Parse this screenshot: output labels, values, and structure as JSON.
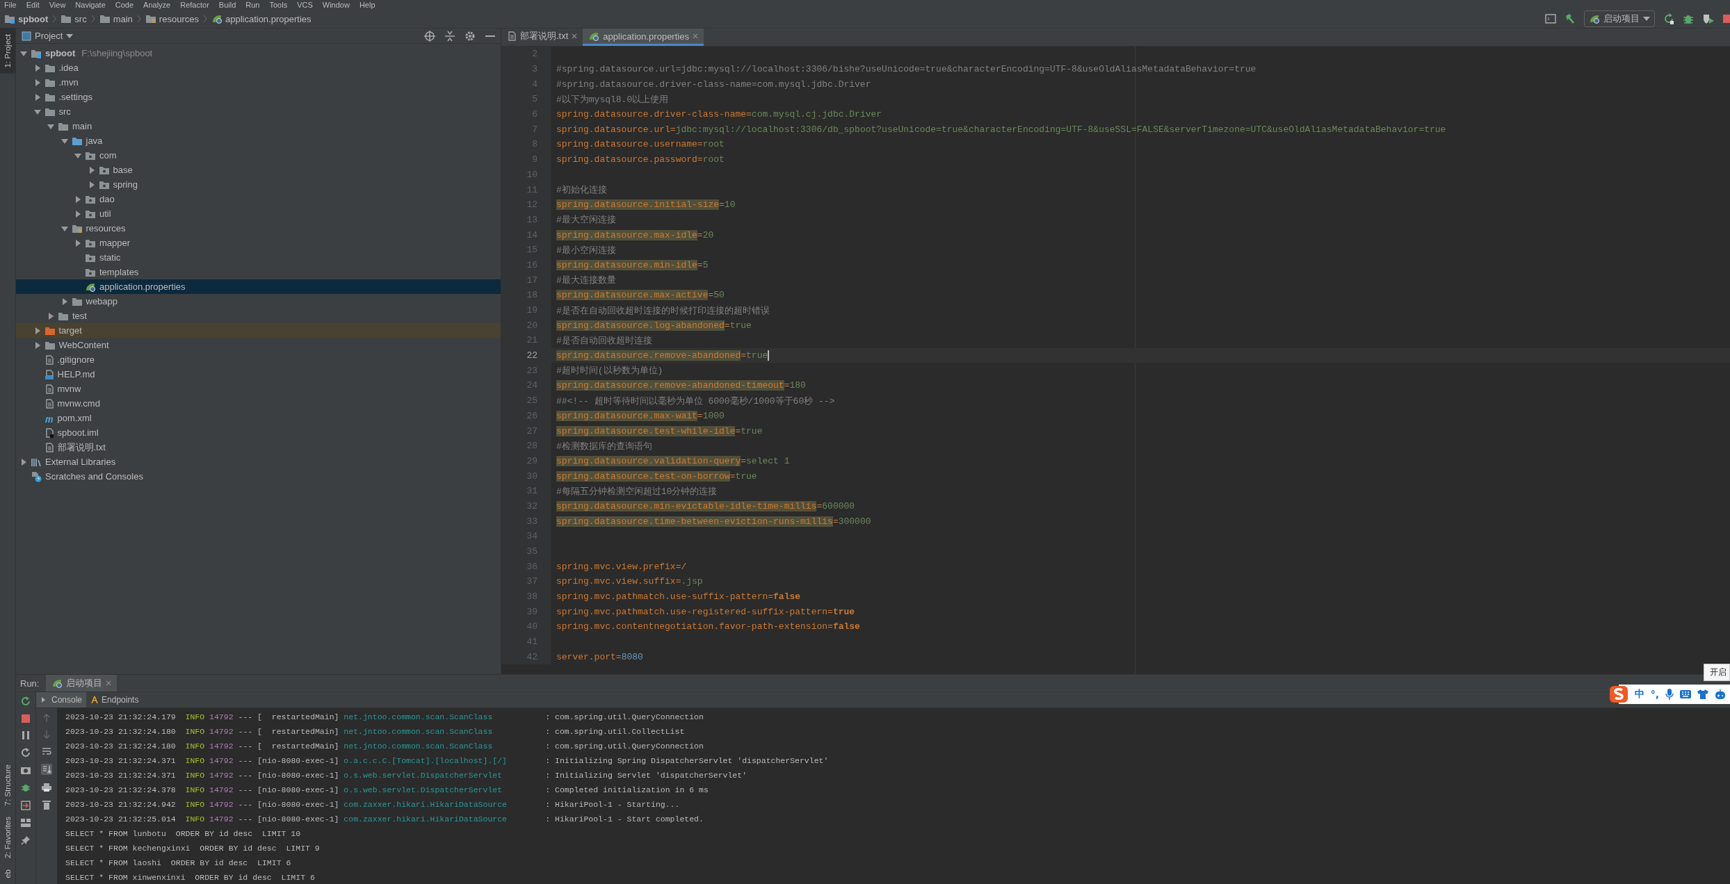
{
  "menu_bar": [
    "File",
    "Edit",
    "View",
    "Navigate",
    "Code",
    "Analyze",
    "Refactor",
    "Build",
    "Run",
    "Tools",
    "VCS",
    "Window",
    "Help"
  ],
  "breadcrumbs": [
    {
      "label": "spboot",
      "kind": "module"
    },
    {
      "label": "src",
      "kind": "folder"
    },
    {
      "label": "main",
      "kind": "folder"
    },
    {
      "label": "resources",
      "kind": "resources-folder"
    },
    {
      "label": "application.properties",
      "kind": "spring-file"
    }
  ],
  "run_config": {
    "label": "启动项目"
  },
  "left_strip": {
    "top": [
      {
        "label": "1: Project",
        "selected": true
      }
    ],
    "bottom": [
      {
        "label": "7: Structure",
        "selected": false
      },
      {
        "label": "2: Favorites",
        "selected": false
      },
      {
        "label": "eb",
        "selected": false
      }
    ]
  },
  "project_panel": {
    "title": "Project"
  },
  "tree": [
    {
      "label": "spboot",
      "kind": "module",
      "path": "F:\\shejiing\\spboot",
      "expanded": true,
      "selected": false,
      "children": [
        {
          "label": ".idea",
          "kind": "folder",
          "expanded": false,
          "selected": false
        },
        {
          "label": ".mvn",
          "kind": "folder",
          "expanded": false,
          "selected": false
        },
        {
          "label": ".settings",
          "kind": "folder",
          "expanded": false,
          "selected": false
        },
        {
          "label": "src",
          "kind": "folder",
          "expanded": true,
          "selected": false,
          "children": [
            {
              "label": "main",
              "kind": "folder",
              "expanded": true,
              "selected": false,
              "children": [
                {
                  "label": "java",
                  "kind": "source-folder",
                  "expanded": true,
                  "selected": false,
                  "children": [
                    {
                      "label": "com",
                      "kind": "package",
                      "expanded": true,
                      "selected": false,
                      "children": [
                        {
                          "label": "base",
                          "kind": "package",
                          "expanded": false,
                          "selected": false
                        },
                        {
                          "label": "spring",
                          "kind": "package",
                          "expanded": false,
                          "selected": false
                        }
                      ]
                    },
                    {
                      "label": "dao",
                      "kind": "package",
                      "expanded": false,
                      "selected": false
                    },
                    {
                      "label": "util",
                      "kind": "package",
                      "expanded": false,
                      "selected": false
                    }
                  ]
                },
                {
                  "label": "resources",
                  "kind": "resources-folder",
                  "expanded": true,
                  "selected": false,
                  "children": [
                    {
                      "label": "mapper",
                      "kind": "package",
                      "expanded": false,
                      "selected": false
                    },
                    {
                      "label": "static",
                      "kind": "package",
                      "selected": false
                    },
                    {
                      "label": "templates",
                      "kind": "package",
                      "selected": false
                    },
                    {
                      "label": "application.properties",
                      "kind": "spring-file",
                      "selected": true
                    }
                  ]
                },
                {
                  "label": "webapp",
                  "kind": "folder",
                  "expanded": false,
                  "selected": false
                }
              ]
            },
            {
              "label": "test",
              "kind": "folder",
              "expanded": false,
              "selected": false
            }
          ]
        },
        {
          "label": "target",
          "kind": "excluded-folder",
          "expanded": false,
          "selected": false
        },
        {
          "label": "WebContent",
          "kind": "folder",
          "expanded": false,
          "selected": false
        },
        {
          "label": ".gitignore",
          "kind": "file",
          "selected": false
        },
        {
          "label": "HELP.md",
          "kind": "markdown",
          "selected": false
        },
        {
          "label": "mvnw",
          "kind": "file",
          "selected": false
        },
        {
          "label": "mvnw.cmd",
          "kind": "file",
          "selected": false
        },
        {
          "label": "pom.xml",
          "kind": "maven",
          "selected": false
        },
        {
          "label": "spboot.iml",
          "kind": "iml",
          "selected": false
        },
        {
          "label": "部署说明.txt",
          "kind": "file",
          "selected": false
        }
      ]
    },
    {
      "label": "External Libraries",
      "kind": "libraries",
      "expanded": false,
      "selected": false
    },
    {
      "label": "Scratches and Consoles",
      "kind": "scratches",
      "selected": false
    }
  ],
  "editor": {
    "tabs": [
      {
        "label": "部署说明.txt",
        "kind": "text-file",
        "selected": false
      },
      {
        "label": "application.properties",
        "kind": "spring-file",
        "selected": true
      }
    ],
    "lines": [
      {
        "n": "2",
        "kind": "blank",
        "current": false
      },
      {
        "n": "3",
        "kind": "comment",
        "text": "#spring.datasource.url=jdbc:mysql://localhost:3306/bishe?useUnicode=true&characterEncoding=UTF-8&useOldAliasMetadataBehavior=true",
        "current": false
      },
      {
        "n": "4",
        "kind": "comment",
        "text": "#spring.datasource.driver-class-name=com.mysql.jdbc.Driver",
        "current": false
      },
      {
        "n": "5",
        "kind": "comment",
        "text": "#以下为mysql8.0以上使用",
        "current": false
      },
      {
        "n": "6",
        "kind": "property",
        "key": "spring.datasource.driver-class-name",
        "sep": "=",
        "value": "com.mysql.cj.jdbc.Driver",
        "flagged": false,
        "current": false
      },
      {
        "n": "7",
        "kind": "property",
        "key": "spring.datasource.url",
        "sep": "=",
        "value": "jdbc:mysql://localhost:3306/db_spboot?useUnicode=true&characterEncoding=UTF-8&useSSL=FALSE&serverTimezone=UTC&useOldAliasMetadataBehavior=true",
        "flagged": false,
        "current": false
      },
      {
        "n": "8",
        "kind": "property",
        "key": "spring.datasource.username",
        "sep": "=",
        "value": "root",
        "flagged": false,
        "current": false
      },
      {
        "n": "9",
        "kind": "property",
        "key": "spring.datasource.password",
        "sep": "=",
        "value": "root",
        "flagged": false,
        "current": false
      },
      {
        "n": "10",
        "kind": "blank",
        "current": false
      },
      {
        "n": "11",
        "kind": "comment",
        "text": "#初始化连接",
        "current": false
      },
      {
        "n": "12",
        "kind": "property",
        "key": "spring.datasource.initial-size",
        "sep": "=",
        "value": "10",
        "flagged": true,
        "current": false
      },
      {
        "n": "13",
        "kind": "comment",
        "text": "#最大空闲连接",
        "current": false
      },
      {
        "n": "14",
        "kind": "property",
        "key": "spring.datasource.max-idle",
        "sep": "=",
        "value": "20",
        "flagged": true,
        "current": false
      },
      {
        "n": "15",
        "kind": "comment",
        "text": "#最小空闲连接",
        "current": false
      },
      {
        "n": "16",
        "kind": "property",
        "key": "spring.datasource.min-idle",
        "sep": "=",
        "value": "5",
        "flagged": true,
        "current": false
      },
      {
        "n": "17",
        "kind": "comment",
        "text": "#最大连接数量",
        "current": false
      },
      {
        "n": "18",
        "kind": "property",
        "key": "spring.datasource.max-active",
        "sep": "=",
        "value": "50",
        "flagged": true,
        "current": false
      },
      {
        "n": "19",
        "kind": "comment",
        "text": "#是否在自动回收超时连接的时候打印连接的超时错误",
        "current": false
      },
      {
        "n": "20",
        "kind": "property",
        "key": "spring.datasource.log-abandoned",
        "sep": "=",
        "value": "true",
        "flagged": true,
        "current": false
      },
      {
        "n": "21",
        "kind": "comment",
        "text": "#是否自动回收超时连接",
        "current": false
      },
      {
        "n": "22",
        "kind": "property",
        "key": "spring.datasource.remove-abandoned",
        "sep": "=",
        "value": "true",
        "flagged": true,
        "current": true
      },
      {
        "n": "23",
        "kind": "comment",
        "text": "#超时时间(以秒数为单位)",
        "current": false
      },
      {
        "n": "24",
        "kind": "property",
        "key": "spring.datasource.remove-abandoned-timeout",
        "sep": "=",
        "value": "180",
        "flagged": true,
        "current": false
      },
      {
        "n": "25",
        "kind": "comment",
        "text": "##<!-- 超时等待时间以毫秒为单位 6000毫秒/1000等于60秒 -->",
        "current": false
      },
      {
        "n": "26",
        "kind": "property",
        "key": "spring.datasource.max-wait",
        "sep": "=",
        "value": "1000",
        "flagged": true,
        "current": false
      },
      {
        "n": "27",
        "kind": "property",
        "key": "spring.datasource.test-while-idle",
        "sep": "=",
        "value": "true",
        "flagged": true,
        "current": false
      },
      {
        "n": "28",
        "kind": "comment",
        "text": "#检测数据库的查询语句",
        "current": false
      },
      {
        "n": "29",
        "kind": "property",
        "key": "spring.datasource.validation-query",
        "sep": "=",
        "value": "select 1",
        "flagged": true,
        "current": false
      },
      {
        "n": "30",
        "kind": "property",
        "key": "spring.datasource.test-on-borrow",
        "sep": "=",
        "value": "true",
        "flagged": true,
        "current": false
      },
      {
        "n": "31",
        "kind": "comment",
        "text": "#每隔五分钟检测空闲超过10分钟的连接",
        "current": false
      },
      {
        "n": "32",
        "kind": "property",
        "key": "spring.datasource.min-evictable-idle-time-millis",
        "sep": "=",
        "value": "600000",
        "flagged": true,
        "current": false
      },
      {
        "n": "33",
        "kind": "property",
        "key": "spring.datasource.time-between-eviction-runs-millis",
        "sep": "=",
        "value": "300000",
        "flagged": true,
        "current": false
      },
      {
        "n": "34",
        "kind": "blank",
        "current": false
      },
      {
        "n": "35",
        "kind": "blank",
        "current": false
      },
      {
        "n": "36",
        "kind": "property-plain",
        "key": "spring.mvc.view.prefix",
        "sep": "=",
        "value": "/",
        "flagged": false,
        "current": false
      },
      {
        "n": "37",
        "kind": "property",
        "key": "spring.mvc.view.suffix",
        "sep": "=",
        "value": ".jsp",
        "flagged": false,
        "current": false
      },
      {
        "n": "38",
        "kind": "property-keyword",
        "key": "spring.mvc.pathmatch.use-suffix-pattern",
        "sep": "=",
        "value": "false",
        "flagged": false,
        "current": false
      },
      {
        "n": "39",
        "kind": "property-keyword",
        "key": "spring.mvc.pathmatch.use-registered-suffix-pattern",
        "sep": "=",
        "value": "true",
        "flagged": false,
        "current": false
      },
      {
        "n": "40",
        "kind": "property-keyword",
        "key": "spring.mvc.contentnegotiation.favor-path-extension",
        "sep": "=",
        "value": "false",
        "flagged": false,
        "current": false
      },
      {
        "n": "41",
        "kind": "blank",
        "current": false
      },
      {
        "n": "42",
        "kind": "property-number",
        "key": "server.port",
        "sep": "=",
        "value": "8080",
        "flagged": false,
        "current": false
      }
    ]
  },
  "run_panel": {
    "label": "Run:",
    "tabs": [
      {
        "label": "启动项目",
        "selected": true
      }
    ],
    "console_tabs": [
      {
        "label": "Console",
        "selected": true
      },
      {
        "label": "Endpoints",
        "selected": false
      }
    ],
    "lines": [
      {
        "kind": "log",
        "time": "2023-10-23 21:32:24.179",
        "level": "INFO",
        "pid": "14792",
        "sep": "---",
        "thread": "[  restartedMain]",
        "logger": "net.jntoo.common.scan.ScanClass",
        "message": ": com.spring.util.QueryConnection"
      },
      {
        "kind": "log",
        "time": "2023-10-23 21:32:24.180",
        "level": "INFO",
        "pid": "14792",
        "sep": "---",
        "thread": "[  restartedMain]",
        "logger": "net.jntoo.common.scan.ScanClass",
        "message": ": com.spring.util.CollectList"
      },
      {
        "kind": "log",
        "time": "2023-10-23 21:32:24.180",
        "level": "INFO",
        "pid": "14792",
        "sep": "---",
        "thread": "[  restartedMain]",
        "logger": "net.jntoo.common.scan.ScanClass",
        "message": ": com.spring.util.QueryConnection"
      },
      {
        "kind": "log",
        "time": "2023-10-23 21:32:24.371",
        "level": "INFO",
        "pid": "14792",
        "sep": "---",
        "thread": "[nio-8080-exec-1]",
        "logger": "o.a.c.c.C.[Tomcat].[localhost].[/]",
        "message": ": Initializing Spring DispatcherServlet 'dispatcherServlet'"
      },
      {
        "kind": "log",
        "time": "2023-10-23 21:32:24.371",
        "level": "INFO",
        "pid": "14792",
        "sep": "---",
        "thread": "[nio-8080-exec-1]",
        "logger": "o.s.web.servlet.DispatcherServlet",
        "message": ": Initializing Servlet 'dispatcherServlet'"
      },
      {
        "kind": "log",
        "time": "2023-10-23 21:32:24.378",
        "level": "INFO",
        "pid": "14792",
        "sep": "---",
        "thread": "[nio-8080-exec-1]",
        "logger": "o.s.web.servlet.DispatcherServlet",
        "message": ": Completed initialization in 6 ms"
      },
      {
        "kind": "log",
        "time": "2023-10-23 21:32:24.942",
        "level": "INFO",
        "pid": "14792",
        "sep": "---",
        "thread": "[nio-8080-exec-1]",
        "logger": "com.zaxxer.hikari.HikariDataSource",
        "message": ": HikariPool-1 - Starting..."
      },
      {
        "kind": "log",
        "time": "2023-10-23 21:32:25.014",
        "level": "INFO",
        "pid": "14792",
        "sep": "---",
        "thread": "[nio-8080-exec-1]",
        "logger": "com.zaxxer.hikari.HikariDataSource",
        "message": ": HikariPool-1 - Start completed."
      },
      {
        "kind": "plain",
        "text": "SELECT * FROM lunbotu  ORDER BY id desc  LIMIT 10"
      },
      {
        "kind": "plain",
        "text": "SELECT * FROM kechengxinxi  ORDER BY id desc  LIMIT 9"
      },
      {
        "kind": "plain",
        "text": "SELECT * FROM laoshi  ORDER BY id desc  LIMIT 6"
      },
      {
        "kind": "plain",
        "text": "SELECT * FROM xinwenxinxi  ORDER BY id desc  LIMIT 6"
      }
    ]
  },
  "ime_bar": {
    "mode": "中",
    "punctuation": "°,",
    "tooltip": "开启"
  }
}
